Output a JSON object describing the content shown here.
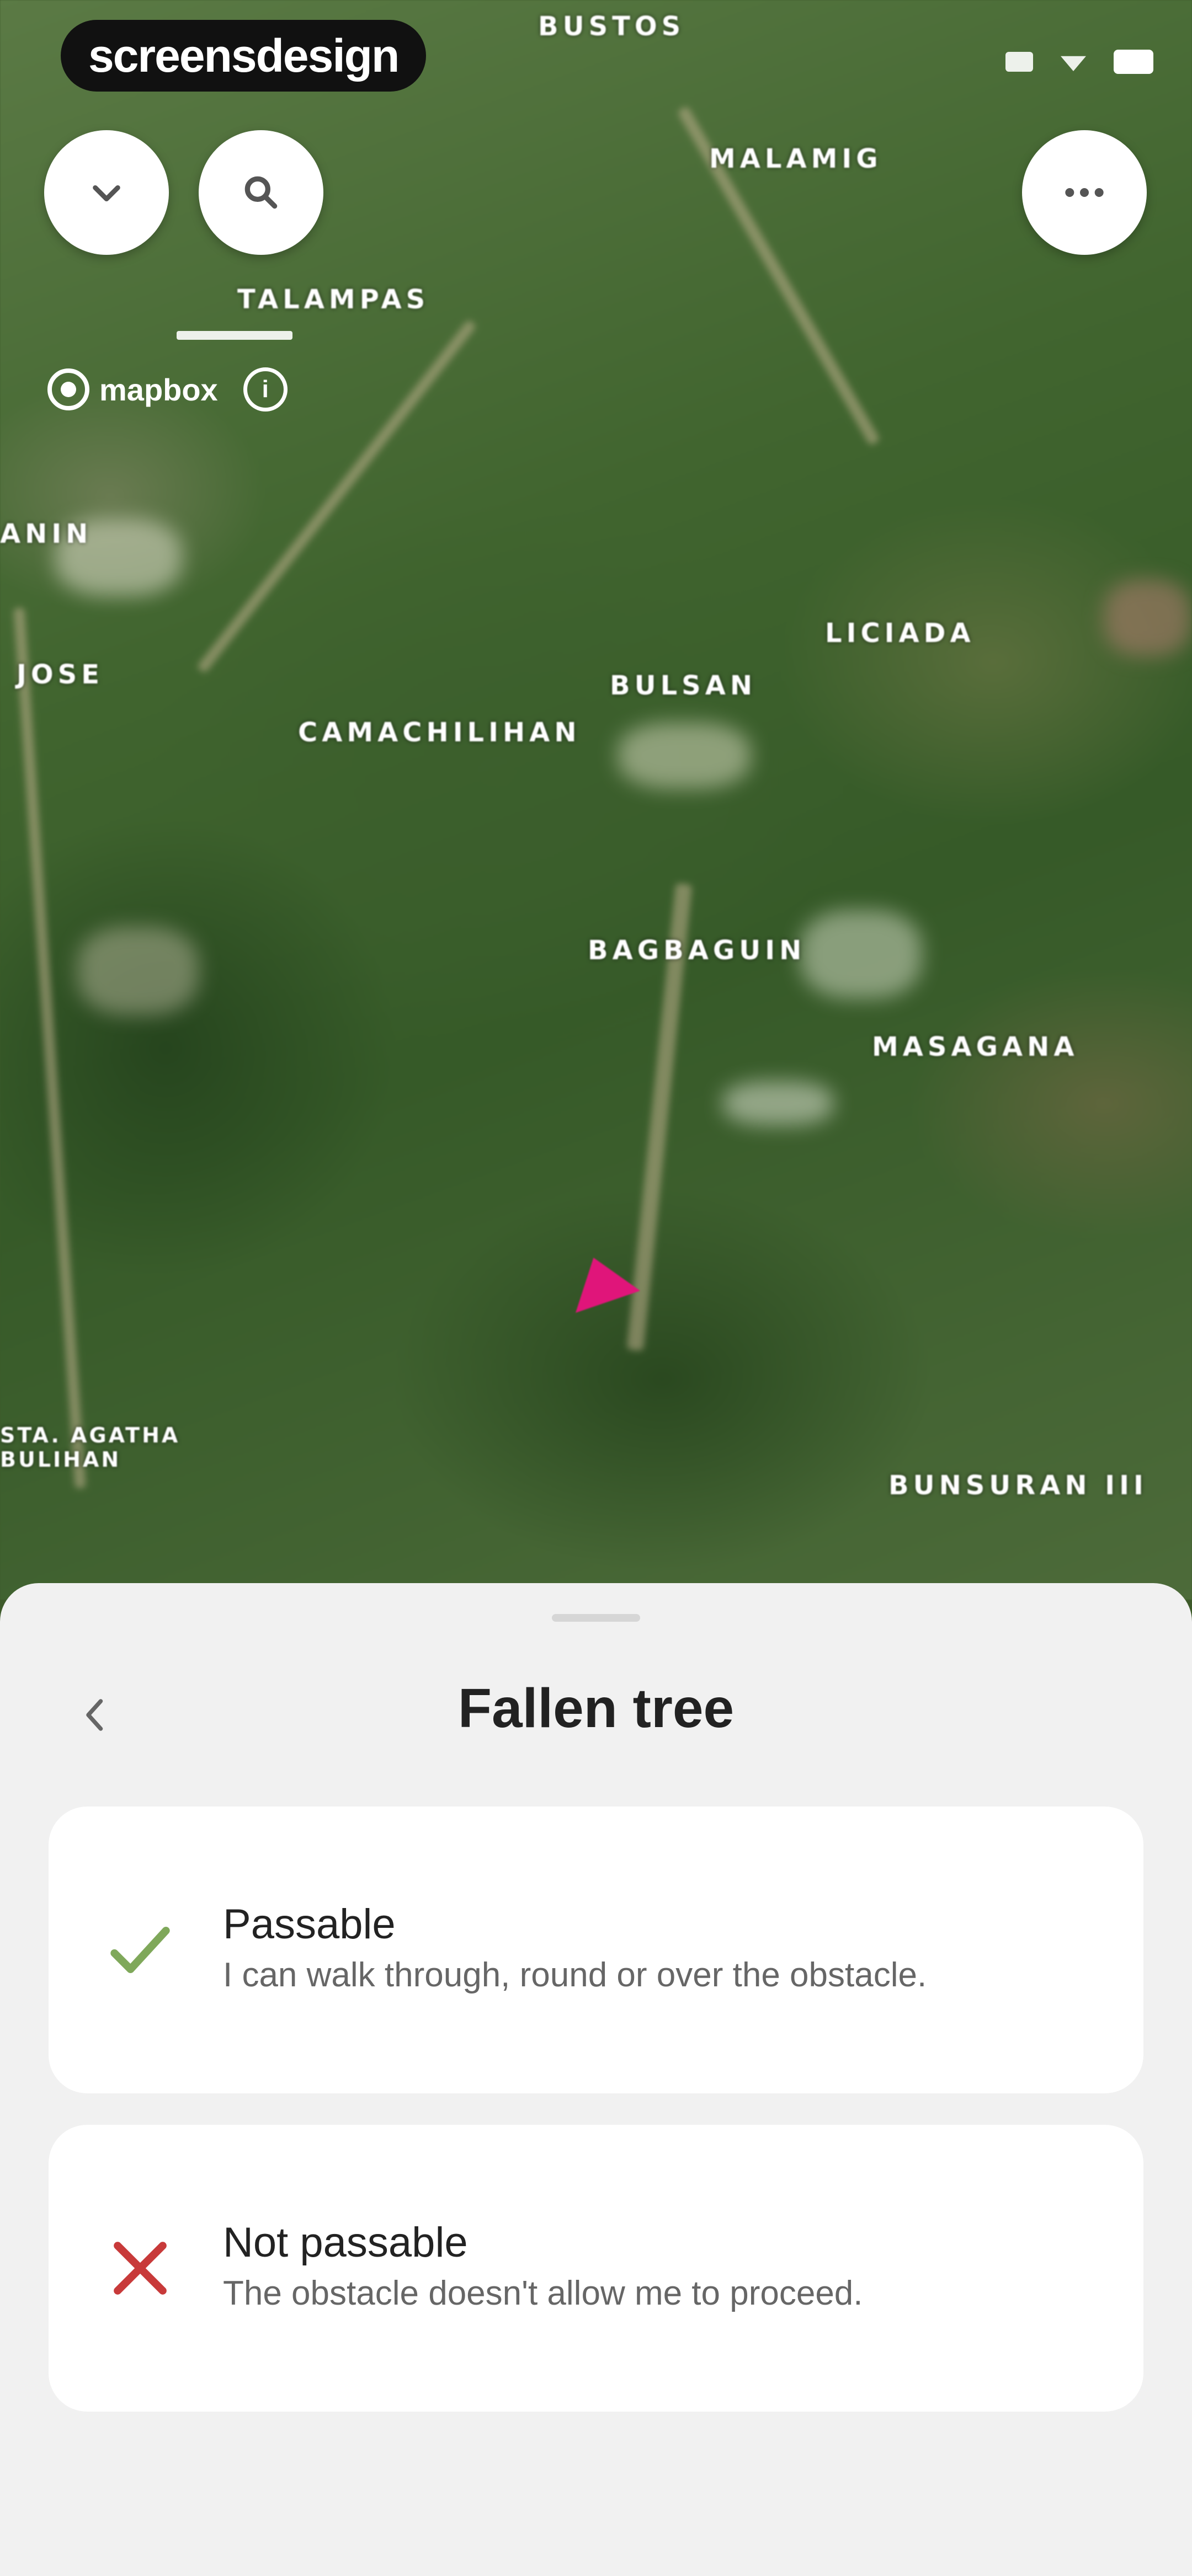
{
  "app": {
    "brand": "screensdesign"
  },
  "map": {
    "labels": [
      "BUSTOS",
      "MALAMIG",
      "TALAMPAS",
      "ANIN",
      "LICIADA",
      "JOSE",
      "BULSAN",
      "CAMACHILIHAN",
      "BAGBAGUIN",
      "MASAGANA",
      "STA. AGATHA BULIHAN",
      "BUNSURAN III"
    ],
    "attribution": "mapbox",
    "info_symbol": "i"
  },
  "toolbar": {
    "collapse_icon": "chevron-down-icon",
    "search_icon": "search-icon",
    "more_icon": "more-horizontal-icon"
  },
  "sheet": {
    "title": "Fallen tree",
    "back_icon": "chevron-left-icon",
    "options": [
      {
        "title": "Passable",
        "description": "I can walk through, round or over the obstacle.",
        "icon": "check-icon",
        "color": "#7fa85a"
      },
      {
        "title": "Not passable",
        "description": "The obstacle doesn't allow me to proceed.",
        "icon": "close-icon",
        "color": "#c83a3a"
      }
    ]
  },
  "colors": {
    "marker": "#e0157a",
    "sheet_bg": "#f1f1f1",
    "card_bg": "#ffffff"
  }
}
